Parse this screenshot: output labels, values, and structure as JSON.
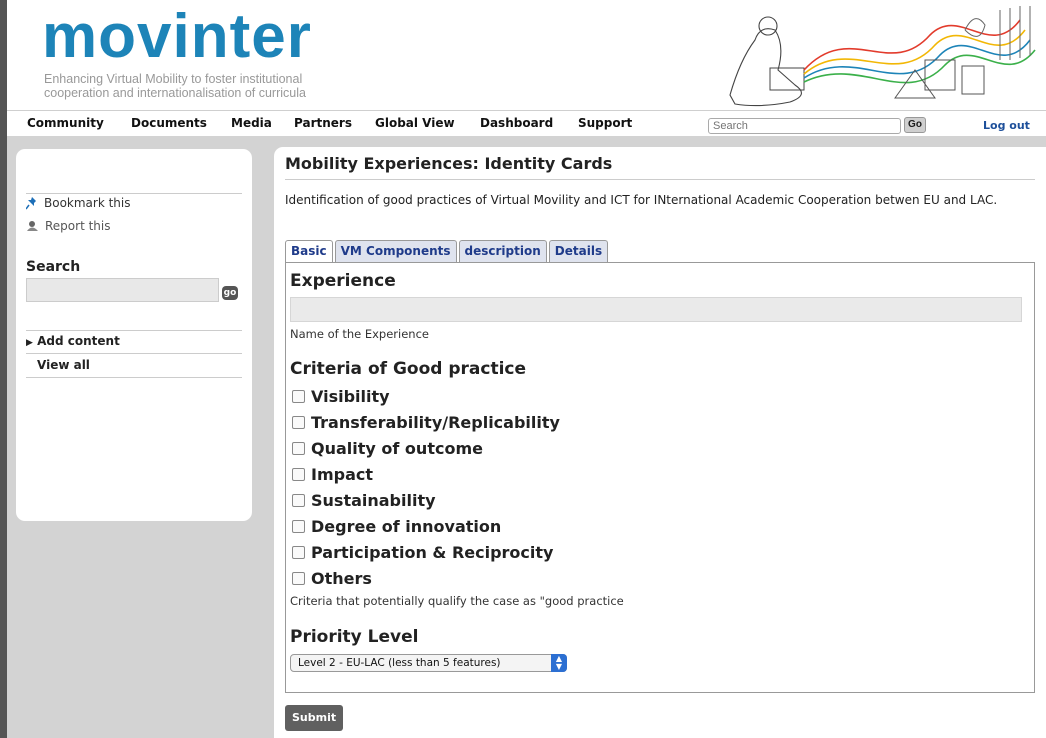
{
  "brand": {
    "logo_text": "movinter",
    "tagline_line1": "Enhancing Virtual Mobility to foster institutional",
    "tagline_line2": "cooperation and internationalisation of curricula"
  },
  "nav": {
    "items": [
      "Community",
      "Documents",
      "Media",
      "Partners",
      "Global View",
      "Dashboard",
      "Support"
    ],
    "search_placeholder": "Search",
    "go_label": "Go",
    "logout_label": "Log out"
  },
  "sidebar": {
    "bookmark_label": "Bookmark this",
    "report_label": "Report this",
    "search_title": "Search",
    "search_go": "go",
    "add_content_label": "Add content",
    "view_all_label": "View all"
  },
  "main": {
    "title": "Mobility Experiences: Identity Cards",
    "intro": "Identification of good practices of Virtual Movility and ICT for INternational Academic Cooperation betwen EU and LAC.",
    "tabs": [
      "Basic",
      "VM Components",
      "description",
      "Details"
    ],
    "active_tab": "Basic",
    "experience_heading": "Experience",
    "experience_value": "",
    "experience_help": "Name of the Experience",
    "criteria_heading": "Criteria of Good practice",
    "criteria": [
      {
        "label": "Visibility",
        "checked": false
      },
      {
        "label": "Transferability/Replicability",
        "checked": false
      },
      {
        "label": "Quality of outcome",
        "checked": false
      },
      {
        "label": "Impact",
        "checked": false
      },
      {
        "label": "Sustainability",
        "checked": false
      },
      {
        "label": "Degree of innovation",
        "checked": false
      },
      {
        "label": "Participation & Reciprocity",
        "checked": false
      },
      {
        "label": "Others",
        "checked": false
      }
    ],
    "criteria_help": "Criteria that potentially qualify the case as \"good practice",
    "priority_heading": "Priority Level",
    "priority_selected": "Level 2 - EU-LAC (less than 5 features)",
    "submit_label": "Submit"
  },
  "colors": {
    "brand_blue": "#1d84b8",
    "tab_text": "#1f3b8a",
    "link_blue": "#1d4f9a",
    "page_gray": "#d3d3d3"
  }
}
